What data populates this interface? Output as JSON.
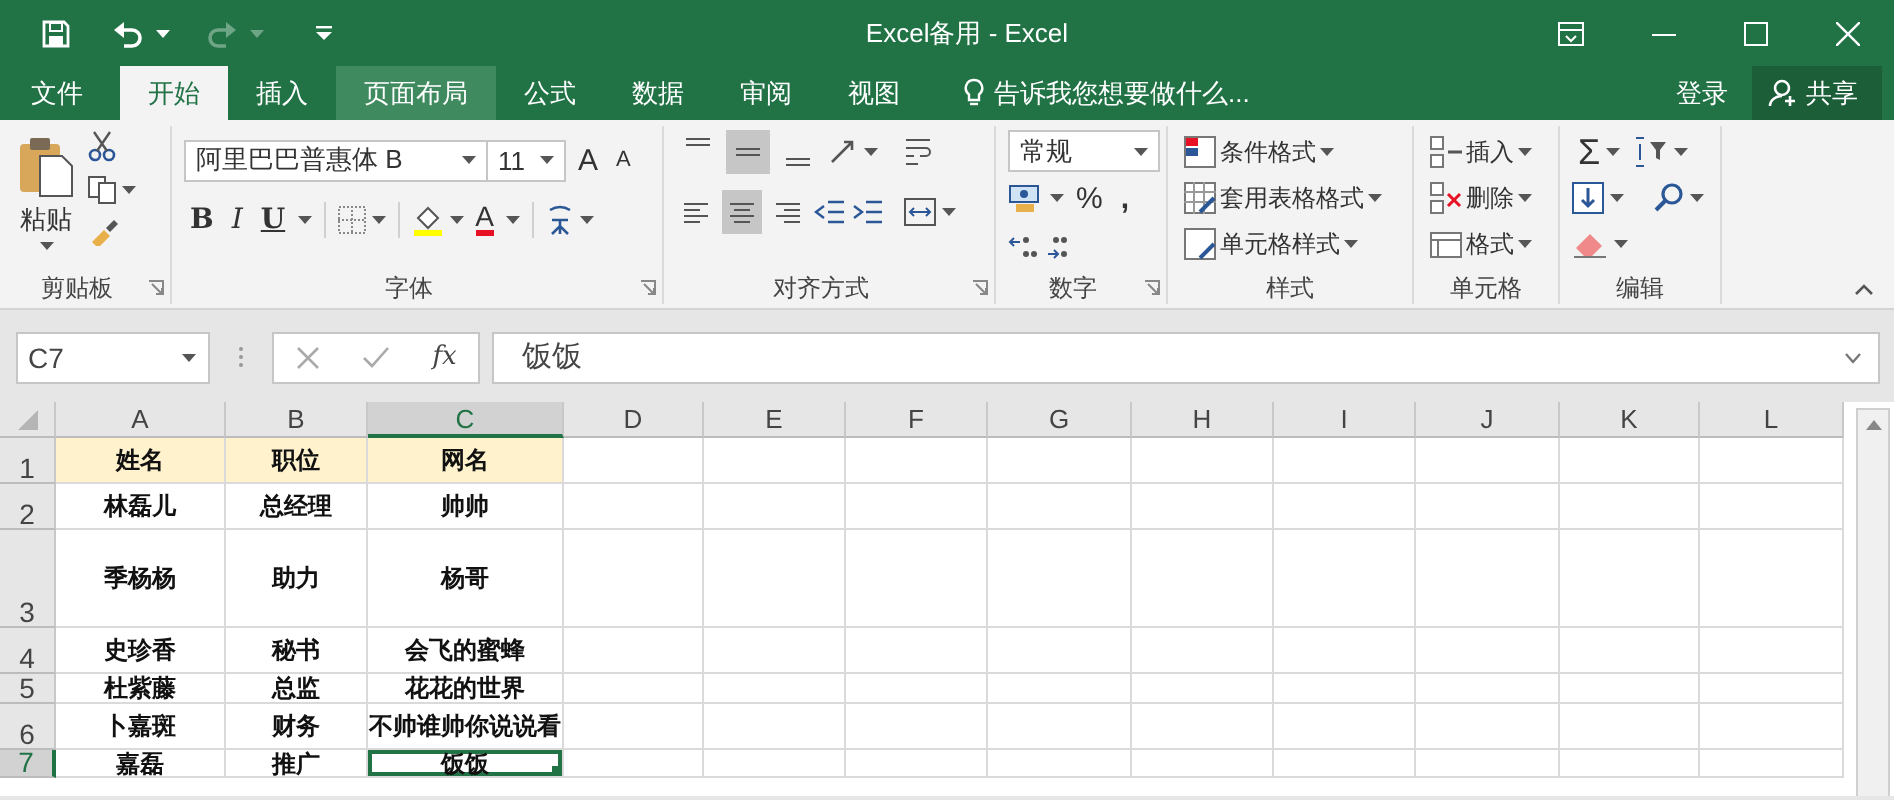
{
  "title_bar": {
    "title": "Excel备用 - Excel",
    "redo_enabled": false
  },
  "tabs": [
    {
      "label": "文件",
      "selected": false,
      "hovered": false
    },
    {
      "label": "开始",
      "selected": true,
      "hovered": false
    },
    {
      "label": "插入",
      "selected": false,
      "hovered": false
    },
    {
      "label": "页面布局",
      "selected": false,
      "hovered": true
    },
    {
      "label": "公式",
      "selected": false,
      "hovered": false
    },
    {
      "label": "数据",
      "selected": false,
      "hovered": false
    },
    {
      "label": "审阅",
      "selected": false,
      "hovered": false
    },
    {
      "label": "视图",
      "selected": false,
      "hovered": false
    }
  ],
  "tell_me": {
    "placeholder": "告诉我您想要做什么..."
  },
  "account": {
    "sign_in": "登录",
    "share": "共享"
  },
  "ribbon": {
    "groups": [
      {
        "kind": "clipboard",
        "label": "剪贴板",
        "launcher": true,
        "paste": "粘贴"
      },
      {
        "kind": "font",
        "label": "字体",
        "launcher": true,
        "font_name": "阿里巴巴普惠体 B",
        "font_size": "11",
        "grow": "A",
        "shrink": "A",
        "bold": "B",
        "italic": "I",
        "underline": "U",
        "font_color": "A"
      },
      {
        "kind": "alignment",
        "label": "对齐方式",
        "launcher": true,
        "vertical": [
          {
            "selected": false
          },
          {
            "selected": true
          },
          {
            "selected": false
          }
        ],
        "horizontal": [
          {
            "selected": false
          },
          {
            "selected": true
          },
          {
            "selected": false
          }
        ]
      },
      {
        "kind": "number",
        "label": "数字",
        "launcher": true,
        "format": "常规",
        "percent": "%",
        "comma": ","
      },
      {
        "kind": "styles",
        "label": "样式",
        "launcher": false,
        "commands": [
          "条件格式",
          "套用表格格式",
          "单元格样式"
        ]
      },
      {
        "kind": "cells",
        "label": "单元格",
        "launcher": false,
        "commands": [
          "插入",
          "删除",
          "格式"
        ]
      },
      {
        "kind": "editing",
        "label": "编辑",
        "launcher": false,
        "sum": "Σ"
      }
    ]
  },
  "formula_bar": {
    "name_box": "C7",
    "fx": "fx",
    "value": "饭饭"
  },
  "sheet": {
    "columns": [
      {
        "label": "A",
        "selected": false
      },
      {
        "label": "B",
        "selected": false
      },
      {
        "label": "C",
        "selected": true
      },
      {
        "label": "D",
        "selected": false
      },
      {
        "label": "E",
        "selected": false
      },
      {
        "label": "F",
        "selected": false
      },
      {
        "label": "G",
        "selected": false
      },
      {
        "label": "H",
        "selected": false
      },
      {
        "label": "I",
        "selected": false
      },
      {
        "label": "J",
        "selected": false
      },
      {
        "label": "K",
        "selected": false
      },
      {
        "label": "L",
        "selected": false
      }
    ],
    "rows": [
      {
        "number": "1",
        "selected": false,
        "kind": "header",
        "cells": [
          {
            "text": "姓名",
            "selected": false
          },
          {
            "text": "职位",
            "selected": false
          },
          {
            "text": "网名",
            "selected": false
          }
        ]
      },
      {
        "number": "2",
        "selected": false,
        "kind": "normal",
        "cells": [
          {
            "text": "林磊儿",
            "selected": false
          },
          {
            "text": "总经理",
            "selected": false
          },
          {
            "text": "帅帅",
            "selected": false
          }
        ]
      },
      {
        "number": "3",
        "selected": false,
        "kind": "normal",
        "cells": [
          {
            "text": "季杨杨",
            "selected": false
          },
          {
            "text": "助力",
            "selected": false
          },
          {
            "text": "杨哥",
            "selected": false
          }
        ]
      },
      {
        "number": "4",
        "selected": false,
        "kind": "normal",
        "cells": [
          {
            "text": "史珍香",
            "selected": false
          },
          {
            "text": "秘书",
            "selected": false
          },
          {
            "text": "会飞的蜜蜂",
            "selected": false
          }
        ]
      },
      {
        "number": "5",
        "selected": false,
        "kind": "normal",
        "cells": [
          {
            "text": "杜紫藤",
            "selected": false
          },
          {
            "text": "总监",
            "selected": false
          },
          {
            "text": "花花的世界",
            "selected": false
          }
        ]
      },
      {
        "number": "6",
        "selected": false,
        "kind": "normal",
        "cells": [
          {
            "text": "卜嘉斑",
            "selected": false
          },
          {
            "text": "财务",
            "selected": false
          },
          {
            "text": "不帅谁帅你说说看",
            "selected": false
          }
        ]
      },
      {
        "number": "7",
        "selected": true,
        "kind": "normal",
        "cells": [
          {
            "text": "嘉磊",
            "selected": false
          },
          {
            "text": "推广",
            "selected": false
          },
          {
            "text": "饭饭",
            "selected": true
          }
        ]
      }
    ]
  }
}
